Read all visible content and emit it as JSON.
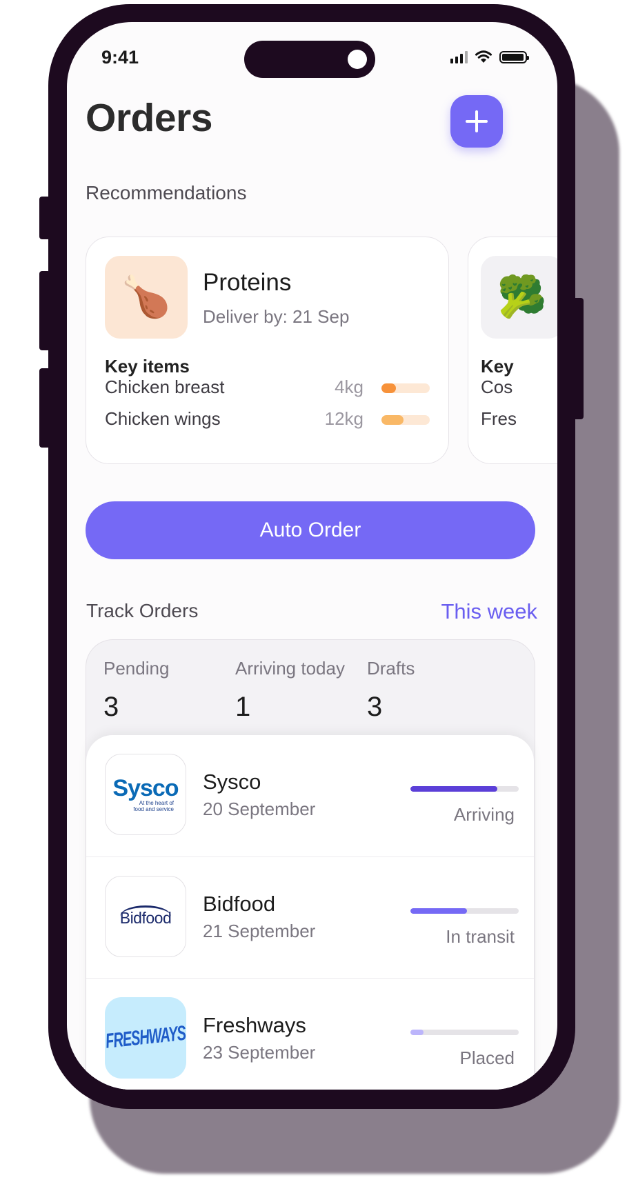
{
  "status_bar": {
    "time": "9:41"
  },
  "header": {
    "title": "Orders"
  },
  "recommendations": {
    "label": "Recommendations",
    "cards": [
      {
        "title": "Proteins",
        "deliver_by": "Deliver by: 21 Sep",
        "icon": "poultry-leg-icon",
        "key_items_label": "Key items",
        "items": [
          {
            "name": "Chicken breast",
            "qty": "4kg",
            "level": 0.3,
            "color": "#f7923a"
          },
          {
            "name": "Chicken wings",
            "qty": "12kg",
            "level": 0.45,
            "color": "#f9b866"
          }
        ]
      },
      {
        "icon": "broccoli-icon",
        "key_items_label": "Key",
        "items": [
          {
            "name": "Cos"
          },
          {
            "name": "Fres"
          }
        ]
      }
    ]
  },
  "auto_order": {
    "label": "Auto Order"
  },
  "track_orders": {
    "label": "Track Orders",
    "period": "This week",
    "stats": [
      {
        "label": "Pending",
        "value": "3"
      },
      {
        "label": "Arriving today",
        "value": "1"
      },
      {
        "label": "Drafts",
        "value": "3"
      }
    ],
    "orders": [
      {
        "supplier": "Sysco",
        "logo_text": "Sysco",
        "logo_tagline": "At the heart of food and service",
        "date": "20 September",
        "status": "Arriving",
        "progress": 0.8,
        "color": "#5b3fd8"
      },
      {
        "supplier": "Bidfood",
        "logo_text": "Bidfood",
        "date": "21 September",
        "status": "In transit",
        "progress": 0.52,
        "color": "#7569f5"
      },
      {
        "supplier": "Freshways",
        "logo_text": "FRESHWAYS",
        "date": "23 September",
        "status": "Placed",
        "progress": 0.12,
        "color": "#bcb5fb"
      }
    ]
  },
  "colors": {
    "accent": "#7569f5",
    "frame": "#1d0a1f",
    "shadow": "#8a7f8c"
  }
}
